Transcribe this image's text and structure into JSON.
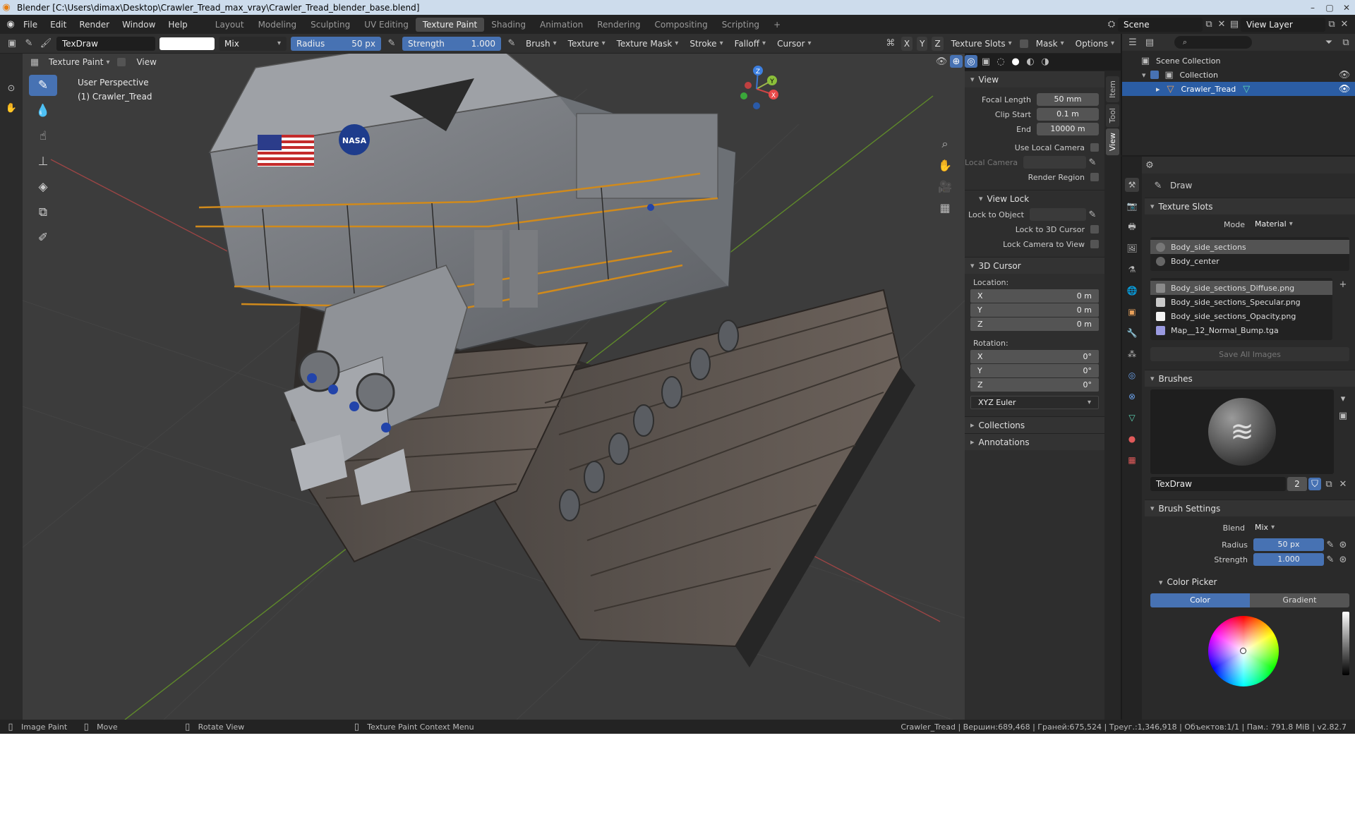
{
  "titlebar": {
    "title": "Blender [C:\\Users\\dimax\\Desktop\\Crawler_Tread_max_vray\\Crawler_Tread_blender_base.blend]",
    "btn_min": "–",
    "btn_max": "▢",
    "btn_close": "✕"
  },
  "menu": {
    "items": [
      "File",
      "Edit",
      "Render",
      "Window",
      "Help"
    ],
    "workspaces": [
      "Layout",
      "Modeling",
      "Sculpting",
      "UV Editing",
      "Texture Paint",
      "Shading",
      "Animation",
      "Rendering",
      "Compositing",
      "Scripting"
    ],
    "active_workspace": "Texture Paint",
    "add_tab": "+",
    "scene_label": "Scene",
    "view_layer_label": "View Layer"
  },
  "tool_header": {
    "brush_name": "TexDraw",
    "blend_mode": "Mix",
    "radius_label": "Radius",
    "radius_value": "50 px",
    "strength_label": "Strength",
    "strength_value": "1.000",
    "dropdowns": [
      "Brush",
      "Texture",
      "Texture Mask",
      "Stroke",
      "Falloff",
      "Cursor"
    ],
    "axis_x": "X",
    "axis_y": "Y",
    "axis_z": "Z",
    "texture_slots": "Texture Slots",
    "mask": "Mask",
    "options": "Options"
  },
  "viewport_header": {
    "mode": "Texture Paint",
    "view": "View"
  },
  "viewport": {
    "perspective": "User Perspective",
    "object": "(1) Crawler_Tread",
    "gizmo_x": "X",
    "gizmo_y": "Y",
    "gizmo_z": "Z",
    "model_label_nasa": "NASA"
  },
  "npanel": {
    "tabs": [
      "Item",
      "Tool",
      "View"
    ],
    "view_section": "View",
    "focal_length_label": "Focal Length",
    "focal_length": "50 mm",
    "clip_start_label": "Clip Start",
    "clip_start": "0.1 m",
    "clip_end_label": "End",
    "clip_end": "10000 m",
    "use_local_camera": "Use Local Camera",
    "local_camera": "Local Camera",
    "render_region": "Render Region",
    "view_lock_section": "View Lock",
    "lock_to_object": "Lock to Object",
    "lock_to_3d_cursor": "Lock to 3D Cursor",
    "lock_camera_to_view": "Lock Camera to View",
    "cursor_section": "3D Cursor",
    "location_label": "Location:",
    "loc_x_label": "X",
    "loc_x": "0 m",
    "loc_y_label": "Y",
    "loc_y": "0 m",
    "loc_z_label": "Z",
    "loc_z": "0 m",
    "rotation_label": "Rotation:",
    "rot_x_label": "X",
    "rot_x": "0°",
    "rot_y_label": "Y",
    "rot_y": "0°",
    "rot_z_label": "Z",
    "rot_z": "0°",
    "rotation_mode": "XYZ Euler",
    "collections_section": "Collections",
    "annotations_section": "Annotations"
  },
  "outliner": {
    "scene_collection": "Scene Collection",
    "collection": "Collection",
    "object": "Crawler_Tread"
  },
  "properties": {
    "tool_name": "Draw",
    "texture_slots_section": "Texture Slots",
    "mode_label": "Mode",
    "mode_value": "Material",
    "materials": [
      "Body_side_sections",
      "Body_center"
    ],
    "images": [
      "Body_side_sections_Diffuse.png",
      "Body_side_sections_Specular.png",
      "Body_side_sections_Opacity.png",
      "Map__12_Normal_Bump.tga"
    ],
    "image_colors": [
      "#8a8a8a",
      "#c8c8c8",
      "#f4f4f4",
      "#9a9ae0"
    ],
    "save_all_images": "Save All Images",
    "brushes_section": "Brushes",
    "brush_name": "TexDraw",
    "brush_users": "2",
    "brush_settings_section": "Brush Settings",
    "blend_label": "Blend",
    "blend_value": "Mix",
    "radius_label": "Radius",
    "radius_value": "50 px",
    "strength_label": "Strength",
    "strength_value": "1.000",
    "color_picker_section": "Color Picker",
    "color_tab": "Color",
    "gradient_tab": "Gradient"
  },
  "statusbar": {
    "image_paint": "Image Paint",
    "move": "Move",
    "rotate_view": "Rotate View",
    "context_menu": "Texture Paint Context Menu",
    "stats": "Crawler_Tread | Вершин:689,468 | Граней:675,524 | Треуг.:1,346,918 | Объектов:1/1 | Пам.: 791.8 MiB | v2.82.7"
  },
  "colors": {
    "accent": "#4772b3",
    "selection": "#2b5da4",
    "grid_x": "#b34a4a",
    "grid_y": "#6a8f2a"
  }
}
